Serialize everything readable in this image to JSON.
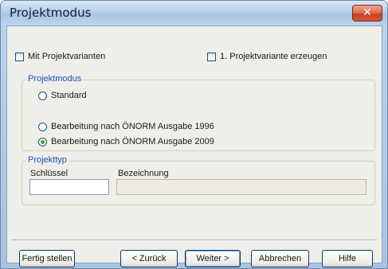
{
  "window": {
    "title": "Projektmodus",
    "close_label": "✕"
  },
  "options": {
    "mit_projektvarianten": {
      "label": "Mit Projektvarianten",
      "checked": false
    },
    "erste_variante": {
      "label": "1. Projektvariante erzeugen",
      "checked": false
    }
  },
  "mode_group": {
    "label": "Projektmodus",
    "options": [
      {
        "label": "Standard",
        "checked": false
      },
      {
        "label": "Bearbeitung nach ÖNORM Ausgabe 1996",
        "checked": false
      },
      {
        "label": "Bearbeitung nach ÖNORM Ausgabe 2009",
        "checked": true
      }
    ]
  },
  "type_group": {
    "label": "Projekttyp",
    "key_label": "Schlüssel",
    "key_value": "",
    "name_label": "Bezeichnung",
    "name_value": ""
  },
  "buttons": {
    "finish": "Fertig stellen",
    "back": "< Zurück",
    "next": "Weiter >",
    "cancel": "Abbrechen",
    "help": "Hilfe"
  },
  "colors": {
    "group_label": "#1e50c4",
    "close_button": "#d9583a",
    "radio_selected": "#3ba53b"
  }
}
